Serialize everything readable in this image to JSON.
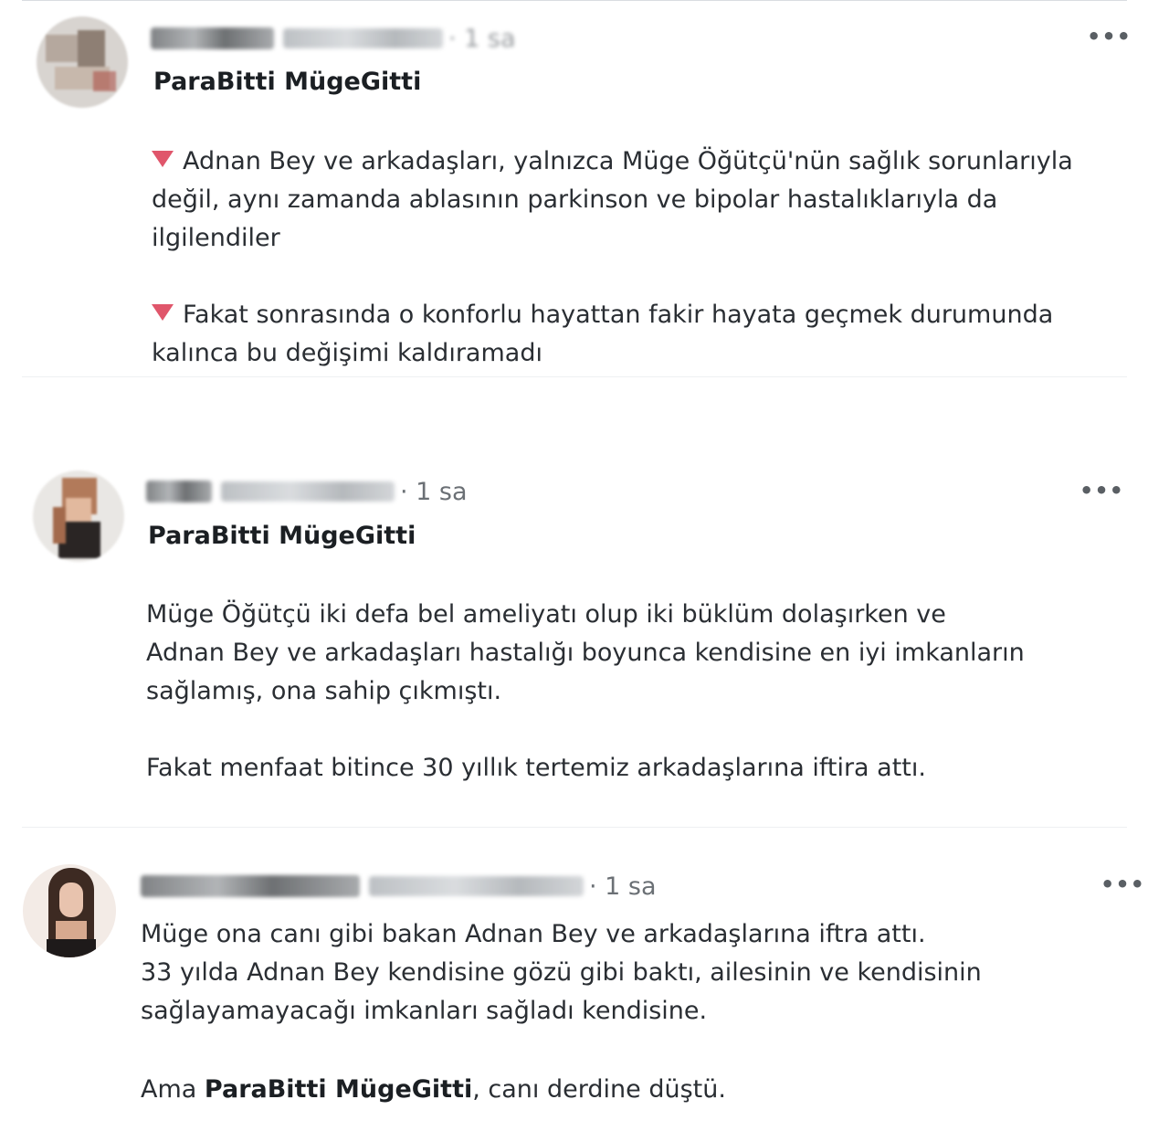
{
  "posts": [
    {
      "time": "· 1 sa",
      "title": "ParaBitti MügeGitti",
      "paragraphs": [
        [
          "Adnan Bey ve arkadaşları, yalnızca Müge Öğütçü'nün sağlık sorunlarıyla",
          "değil, aynı zamanda ablasının parkinson ve bipolar hastalıklarıyla da",
          "ilgilendiler"
        ],
        [
          "Fakat sonrasında o konforlu hayattan fakir hayata geçmek durumunda",
          "kalınca bu değişimi kaldıramadı"
        ]
      ]
    },
    {
      "time": "· 1 sa",
      "title": "ParaBitti MügeGitti",
      "paragraphs": [
        [
          "Müge Öğütçü iki defa bel ameliyatı olup iki büklüm dolaşırken ve",
          "Adnan Bey ve arkadaşları hastalığı boyunca kendisine en iyi imkanların",
          "sağlamış, ona sahip çıkmıştı."
        ],
        [
          "Fakat menfaat bitince 30 yıllık tertemiz arkadaşlarına iftira attı."
        ]
      ]
    },
    {
      "time": "· 1 sa",
      "paragraphs": [
        [
          "Müge ona canı gibi bakan Adnan Bey ve arkadaşlarına iftra attı.",
          "33 yılda Adnan Bey kendisine gözü gibi baktı, ailesinin ve kendisinin",
          "sağlayamayacağı imkanları sağladı kendisine."
        ]
      ],
      "closing": {
        "prefix": "Ama ",
        "bold": "ParaBitti MügeGitti",
        "suffix": ", canı derdine düştü."
      }
    }
  ],
  "icons": {
    "more": "more-icon",
    "bullet": "red-triangle-down-icon"
  },
  "colors": {
    "bullet": "#e0566b",
    "time": "#6b7075",
    "divider": "#eef0f2"
  }
}
